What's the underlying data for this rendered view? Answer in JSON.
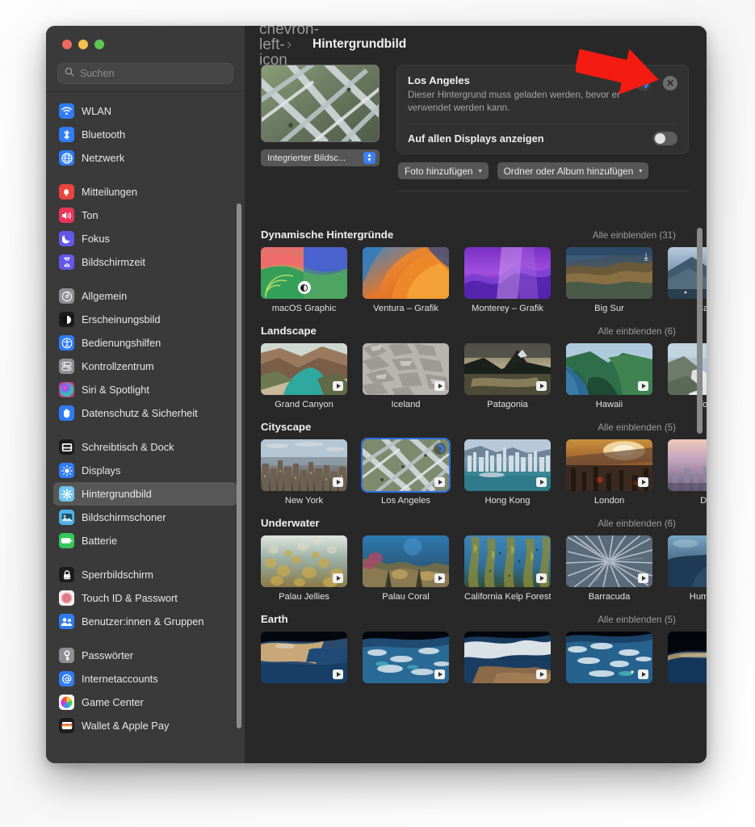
{
  "window": {
    "traffic_lights": [
      "close",
      "minimize",
      "zoom"
    ],
    "search": {
      "placeholder": "Suchen",
      "value": "",
      "icon": "search-icon"
    }
  },
  "sidebar": {
    "groups": [
      {
        "items": [
          {
            "label": "WLAN",
            "icon": "wifi-icon",
            "color": "#2f7cf6",
            "selected": false
          },
          {
            "label": "Bluetooth",
            "icon": "bluetooth-icon",
            "color": "#2f7cf6",
            "selected": false
          },
          {
            "label": "Netzwerk",
            "icon": "globe-icon",
            "color": "#2f7cf6",
            "selected": false
          }
        ]
      },
      {
        "items": [
          {
            "label": "Mitteilungen",
            "icon": "bell-icon",
            "color": "#e8453c",
            "selected": false
          },
          {
            "label": "Ton",
            "icon": "speaker-icon",
            "color": "#e8355a",
            "selected": false
          },
          {
            "label": "Fokus",
            "icon": "moon-icon",
            "color": "#6457e8",
            "selected": false
          },
          {
            "label": "Bildschirmzeit",
            "icon": "hourglass-icon",
            "color": "#6457e8",
            "selected": false
          }
        ]
      },
      {
        "items": [
          {
            "label": "Allgemein",
            "icon": "gear-icon",
            "color": "#8e8e93",
            "selected": false
          },
          {
            "label": "Erscheinungsbild",
            "icon": "appearance-icon",
            "color": "#1c1c1e",
            "selected": false
          },
          {
            "label": "Bedienungshilfen",
            "icon": "accessibility-icon",
            "color": "#2f7cf6",
            "selected": false
          },
          {
            "label": "Kontrollzentrum",
            "icon": "control-center-icon",
            "color": "#8e8e93",
            "selected": false
          },
          {
            "label": "Siri & Spotlight",
            "icon": "siri-icon",
            "color": "#c2467f",
            "selected": false
          },
          {
            "label": "Datenschutz & Sicherheit",
            "icon": "hand-icon",
            "color": "#2f7cf6",
            "selected": false
          }
        ]
      },
      {
        "items": [
          {
            "label": "Schreibtisch & Dock",
            "icon": "dock-icon",
            "color": "#1c1c1e",
            "selected": false
          },
          {
            "label": "Displays",
            "icon": "brightness-icon",
            "color": "#2f7cf6",
            "selected": false
          },
          {
            "label": "Hintergrundbild",
            "icon": "wallpaper-icon",
            "color": "#6fc6ef",
            "selected": true
          },
          {
            "label": "Bildschirmschoner",
            "icon": "screensaver-icon",
            "color": "#4fb3e8",
            "selected": false
          },
          {
            "label": "Batterie",
            "icon": "battery-icon",
            "color": "#34c759",
            "selected": false
          }
        ]
      },
      {
        "items": [
          {
            "label": "Sperrbildschirm",
            "icon": "lock-icon",
            "color": "#1c1c1e",
            "selected": false
          },
          {
            "label": "Touch ID & Passwort",
            "icon": "fingerprint-icon",
            "color": "#f2f2f2",
            "selected": false
          },
          {
            "label": "Benutzer:innen & Gruppen",
            "icon": "users-icon",
            "color": "#2f7cf6",
            "selected": false
          }
        ]
      },
      {
        "items": [
          {
            "label": "Passwörter",
            "icon": "key-icon",
            "color": "#8e8e93",
            "selected": false
          },
          {
            "label": "Internetaccounts",
            "icon": "at-icon",
            "color": "#2f7cf6",
            "selected": false
          },
          {
            "label": "Game Center",
            "icon": "game-center-icon",
            "color": "#f5f5f5",
            "selected": false
          },
          {
            "label": "Wallet & Apple Pay",
            "icon": "wallet-icon",
            "color": "#1c1c1e",
            "selected": false
          }
        ]
      }
    ]
  },
  "header": {
    "back_icon": "chevron-left-icon",
    "forward_icon": "chevron-right-icon",
    "title": "Hintergrundbild"
  },
  "preview": {
    "thumbnail_name": "los-angeles-preview",
    "display_select": {
      "value": "Integrierter Bildsc...",
      "icon": "stepper-icon"
    }
  },
  "info_card": {
    "name": "Los Angeles",
    "description": "Dieser Hintergrund muss geladen werden, bevor er verwendet werden kann.",
    "spinner": "loading-spinner",
    "close_icon": "✕",
    "all_displays_label": "Auf allen Displays anzeigen",
    "all_displays_on": false
  },
  "buttons": {
    "add_photo": {
      "label": "Foto hinzufügen",
      "caret": "▾"
    },
    "add_folder": {
      "label": "Ordner oder Album hinzufügen",
      "caret": "▾"
    }
  },
  "sections": [
    {
      "title": "Dynamische Hintergründe",
      "show_all": "Alle einblenden (31)",
      "tiles": [
        {
          "caption": "macOS Graphic",
          "badge": "appearance",
          "selected": false,
          "art": "macos-graphic"
        },
        {
          "caption": "Ventura – Grafik",
          "badge": "none",
          "selected": false,
          "art": "ventura"
        },
        {
          "caption": "Monterey – Grafik",
          "badge": "none",
          "selected": false,
          "art": "monterey"
        },
        {
          "caption": "Big Sur",
          "badge": "cloud",
          "selected": false,
          "art": "bigsur"
        },
        {
          "caption": "Catalin",
          "badge": "none",
          "selected": false,
          "art": "catalina"
        }
      ]
    },
    {
      "title": "Landscape",
      "show_all": "Alle einblenden (6)",
      "tiles": [
        {
          "caption": "Grand Canyon",
          "badge": "play",
          "selected": false,
          "art": "grand-canyon"
        },
        {
          "caption": "Iceland",
          "badge": "play",
          "selected": false,
          "art": "iceland"
        },
        {
          "caption": "Patagonia",
          "badge": "play",
          "selected": false,
          "art": "patagonia"
        },
        {
          "caption": "Hawaii",
          "badge": "play",
          "selected": false,
          "art": "hawaii"
        },
        {
          "caption": "Yosem",
          "badge": "none",
          "selected": false,
          "art": "yosemite"
        }
      ]
    },
    {
      "title": "Cityscape",
      "show_all": "Alle einblenden (5)",
      "tiles": [
        {
          "caption": "New York",
          "badge": "play",
          "selected": false,
          "art": "new-york"
        },
        {
          "caption": "Los Angeles",
          "badge": "play",
          "selected": true,
          "art": "los-angeles"
        },
        {
          "caption": "Hong Kong",
          "badge": "play",
          "selected": false,
          "art": "hong-kong"
        },
        {
          "caption": "London",
          "badge": "play",
          "selected": false,
          "art": "london"
        },
        {
          "caption": "Duba",
          "badge": "none",
          "selected": false,
          "art": "dubai"
        }
      ]
    },
    {
      "title": "Underwater",
      "show_all": "Alle einblenden (6)",
      "tiles": [
        {
          "caption": "Palau Jellies",
          "badge": "play",
          "selected": false,
          "art": "palau-jellies"
        },
        {
          "caption": "Palau Coral",
          "badge": "play",
          "selected": false,
          "art": "palau-coral"
        },
        {
          "caption": "California Kelp Forest",
          "badge": "play",
          "selected": false,
          "art": "kelp"
        },
        {
          "caption": "Barracuda",
          "badge": "play",
          "selected": false,
          "art": "barracuda"
        },
        {
          "caption": "Humpback",
          "badge": "none",
          "selected": false,
          "art": "humpback"
        }
      ]
    },
    {
      "title": "Earth",
      "show_all": "Alle einblenden (5)",
      "tiles": [
        {
          "caption": "",
          "badge": "play",
          "selected": false,
          "art": "earth1"
        },
        {
          "caption": "",
          "badge": "play",
          "selected": false,
          "art": "earth2"
        },
        {
          "caption": "",
          "badge": "play",
          "selected": false,
          "art": "earth3"
        },
        {
          "caption": "",
          "badge": "play",
          "selected": false,
          "art": "earth4"
        },
        {
          "caption": "",
          "badge": "none",
          "selected": false,
          "art": "earth5"
        }
      ]
    }
  ],
  "annotation": {
    "type": "red-arrow",
    "color": "#f41b13",
    "points_to": "loading-spinner"
  }
}
